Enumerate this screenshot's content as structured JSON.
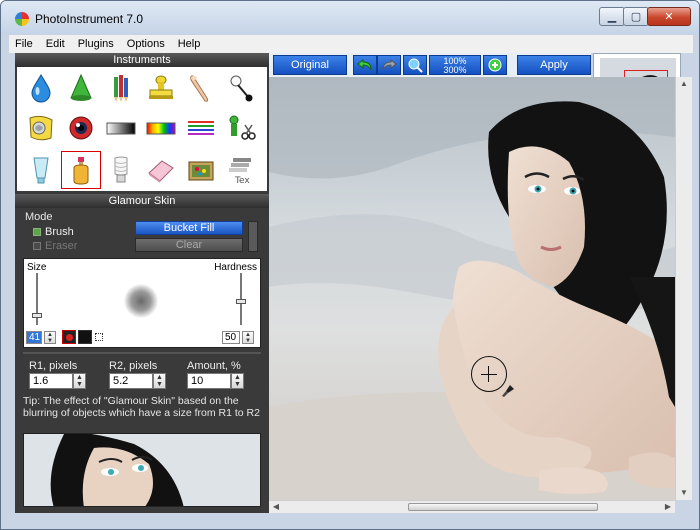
{
  "window": {
    "title": "PhotoInstrument 7.0"
  },
  "menu": [
    "File",
    "Edit",
    "Plugins",
    "Options",
    "Help"
  ],
  "instruments": {
    "header": "Instruments",
    "tools": [
      {
        "icon": "water-drop-icon"
      },
      {
        "icon": "green-cone-icon"
      },
      {
        "icon": "pencils-icon"
      },
      {
        "icon": "stamp-icon"
      },
      {
        "icon": "finger-smudge-icon"
      },
      {
        "icon": "pin-icon"
      },
      {
        "icon": "warp-icon"
      },
      {
        "icon": "red-eye-icon"
      },
      {
        "icon": "gradient-bar-icon"
      },
      {
        "icon": "color-bar-icon"
      },
      {
        "icon": "color-lines-icon"
      },
      {
        "icon": "clone-scissors-icon"
      },
      {
        "icon": "tube-icon"
      },
      {
        "icon": "bottle-icon"
      },
      {
        "icon": "cfl-bulb-icon"
      },
      {
        "icon": "eraser-icon"
      },
      {
        "icon": "texture-box-icon"
      },
      {
        "icon": "text-layers-icon"
      }
    ],
    "selected_index": 13
  },
  "glamour": {
    "header": "Glamour Skin",
    "mode_label": "Mode",
    "brush_label": "Brush",
    "eraser_label": "Eraser",
    "bucket_fill": "Bucket Fill",
    "clear": "Clear",
    "size_label": "Size",
    "hardness_label": "Hardness",
    "size_value": "41",
    "hardness_value": "50",
    "r1_label": "R1, pixels",
    "r2_label": "R2, pixels",
    "amount_label": "Amount, %",
    "r1_value": "1.6",
    "r2_value": "5.2",
    "amount_value": "10",
    "tip": "Tip: The effect of \"Glamour Skin\" based on the blurring of objects which have a size from R1 to R2"
  },
  "toolbar": {
    "original": "Original",
    "apply": "Apply",
    "zoom_top": "100%",
    "zoom_bottom": "300%"
  },
  "colors": {
    "accent": "#1a55c4",
    "panel_bg": "#3a3a3a",
    "selection": "#d80000"
  }
}
